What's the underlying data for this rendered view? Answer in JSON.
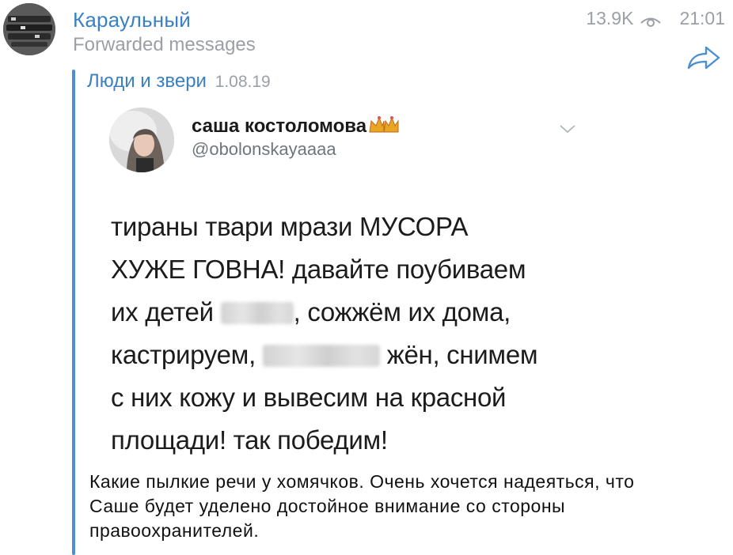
{
  "channel": {
    "name": "Караульный",
    "subtitle": "Forwarded messages",
    "views": "13.9K",
    "time": "21:01"
  },
  "forward": {
    "source_name": "Люди и звери",
    "source_date": "1.08.19"
  },
  "tweet": {
    "display_name": "саша костоломова",
    "handle": "@obolonskayaaaa",
    "lines": [
      "тираны твари мрази МУСОРА",
      "ХУЖЕ ГОВНА! давайте поубиваем",
      "их детей",
      ", сожжём их дома,",
      "кастрируем,",
      "жён, снимем",
      "с них кожу и вывесим на красной",
      "площади! так победим!"
    ]
  },
  "caption": {
    "text": "Какие пылкие речи у хомячков. Очень хочется надеяться, что Саше будет уделено достойное внимание со стороны правоохранителей."
  },
  "icons": {
    "views": "eye-icon",
    "share": "share-arrow-icon",
    "tweet_menu": "chevron-down-icon",
    "emoji": "crown-icon"
  },
  "colors": {
    "link_blue": "#3a80c2",
    "forward_bar": "#4b8fd1",
    "muted_gray": "#9aa0a6"
  }
}
